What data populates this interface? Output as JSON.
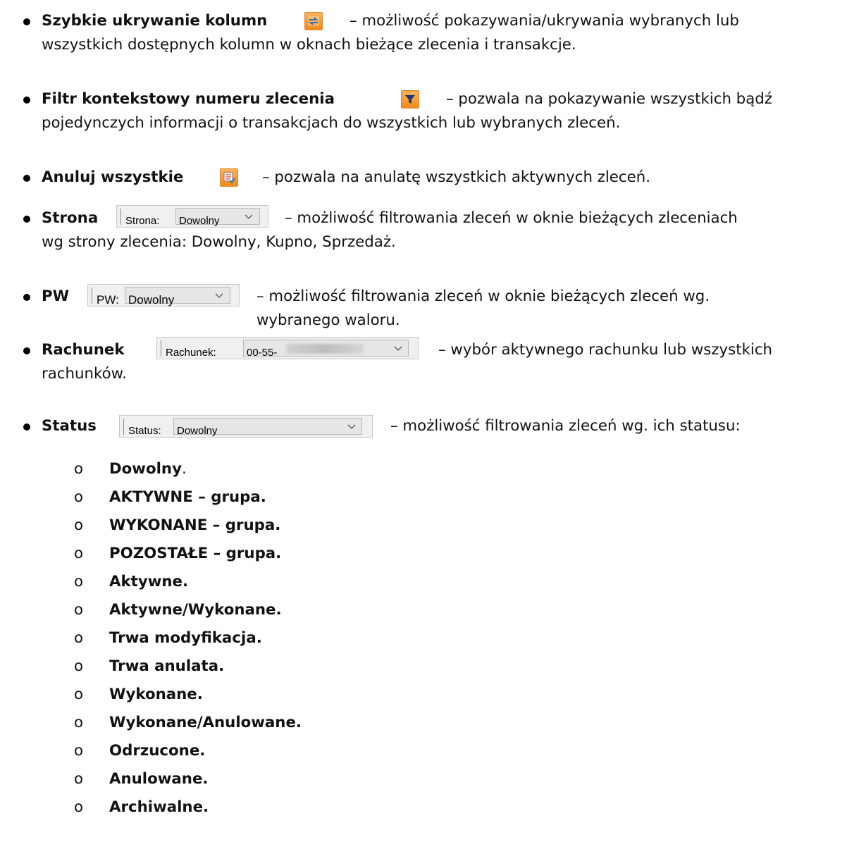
{
  "items": [
    {
      "term": "Szybkie ukrywanie kolumn",
      "desc_line1": "– możliwość pokazywania/ukrywania wybranych lub",
      "desc_line2": "wszystkich dostępnych kolumn w oknach bieżące zlecenia i transakcje.",
      "icon": "columns-toggle-icon"
    },
    {
      "term": "Filtr kontekstowy numeru zlecenia",
      "desc_line1": "– pozwala na pokazywanie wszystkich bądź",
      "desc_line2": "pojedynczych informacji o transakcjach do wszystkich lub wybranych zleceń.",
      "icon": "funnel-filter-icon"
    },
    {
      "term": "Anuluj wszystkie",
      "desc_line1": "– pozwala na anulatę wszystkich aktywnych zleceń.",
      "icon": "cancel-all-icon"
    },
    {
      "term": "Strona",
      "desc_line1": "– możliwość filtrowania zleceń w oknie bieżących zleceniach",
      "desc_line2": "wg strony zlecenia: Dowolny, Kupno, Sprzedaż.",
      "control": {
        "label": "Strona:",
        "value": "Dowolny"
      }
    },
    {
      "term": "PW",
      "desc_line1": "– możliwość filtrowania zleceń w oknie bieżących zleceń wg.",
      "desc_line2": "wybranego waloru.",
      "control": {
        "label": "PW:",
        "value": "Dowolny"
      }
    },
    {
      "term": "Rachunek",
      "desc_line1": "– wybór aktywnego rachunku lub wszystkich",
      "desc_line2": "rachunków.",
      "control": {
        "label": "Rachunek:",
        "value": "00-55-"
      }
    },
    {
      "term": "Status",
      "desc_line1": "– możliwość filtrowania zleceń wg. ich statusu:",
      "control": {
        "label": "Status:",
        "value": "Dowolny"
      }
    }
  ],
  "status_list_marker": "o",
  "status_list": [
    "Dowolny",
    "AKTYWNE – grupa.",
    "WYKONANE – grupa.",
    "POZOSTAŁE – grupa.",
    "Aktywne.",
    "Aktywne/Wykonane.",
    "Trwa modyfikacja.",
    "Trwa anulata.",
    "Wykonane.",
    "Wykonane/Anulowane.",
    "Odrzucone.",
    "Anulowane.",
    "Archiwalne."
  ],
  "status_first_suffix": "."
}
